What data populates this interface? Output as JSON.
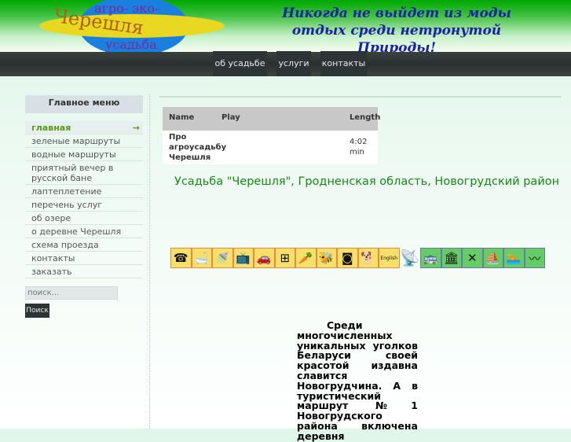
{
  "header": {
    "logo": {
      "top": "агро- эко-",
      "middle": "Черешля",
      "bottom": "усадьба"
    },
    "slogan_line1": "Никогда не выйдет из моды",
    "slogan_line2": "отдых среди нетронутой Природы!"
  },
  "nav": [
    "об усадьбе",
    "услуги",
    "контакты"
  ],
  "menu": {
    "title": "Главное меню",
    "items": [
      "главная",
      "зеленые маршруты",
      "водные маршруты",
      "приятный вечер в русской бане",
      "лаптеплетение",
      "перечень услуг",
      "об озере",
      "о деревне Черешля",
      "схема проезда",
      "контакты",
      "заказать"
    ],
    "active_arrow": "→"
  },
  "search": {
    "placeholder": "поиск...",
    "button": "Поиск"
  },
  "playlist": {
    "headers": [
      "Name",
      "Play",
      "Length"
    ],
    "rows": [
      {
        "name": "Про агроусадьбу Черешля",
        "length": "4:02 min"
      }
    ]
  },
  "caption": "Усадьба \"Черешля\", Гродненская область, Новогрудский район",
  "amenities": [
    {
      "icon": "phone-icon",
      "glyph": "☎",
      "c": "y"
    },
    {
      "icon": "bath-icon",
      "glyph": "🛁",
      "c": "y"
    },
    {
      "icon": "shower-icon",
      "glyph": "🚿",
      "c": "y"
    },
    {
      "icon": "tv-icon",
      "glyph": "📺",
      "c": "y"
    },
    {
      "icon": "parking-icon",
      "glyph": "🚗",
      "c": "y"
    },
    {
      "icon": "stove-icon",
      "glyph": "⊞",
      "c": "y"
    },
    {
      "icon": "cooking-icon",
      "glyph": "🥕",
      "c": "y"
    },
    {
      "icon": "bees-icon",
      "glyph": "🐝",
      "c": "y"
    },
    {
      "icon": "washing-machine-icon",
      "glyph": "◙",
      "c": "y"
    },
    {
      "icon": "dog-icon",
      "glyph": "🐕",
      "c": "y"
    },
    {
      "icon": "english-icon",
      "glyph": "English",
      "c": "y"
    },
    {
      "icon": "satellite-icon",
      "glyph": "📡",
      "c": "n"
    },
    {
      "icon": "bus-icon",
      "glyph": "🚌",
      "c": "g"
    },
    {
      "icon": "museum-icon",
      "glyph": "🏛",
      "c": "g"
    },
    {
      "icon": "restaurant-icon",
      "glyph": "✕",
      "c": "g"
    },
    {
      "icon": "boat-icon",
      "glyph": "⛵",
      "c": "g"
    },
    {
      "icon": "swimming-icon",
      "glyph": "🏊",
      "c": "g"
    },
    {
      "icon": "fishing-icon",
      "glyph": "〰",
      "c": "g"
    }
  ],
  "paragraph": "Среди многочисленных уникальных уголков Беларуси своей красотой издавна славится Новогрудчина. А в туристический маршрут №1 Новогрудского района включена деревня"
}
